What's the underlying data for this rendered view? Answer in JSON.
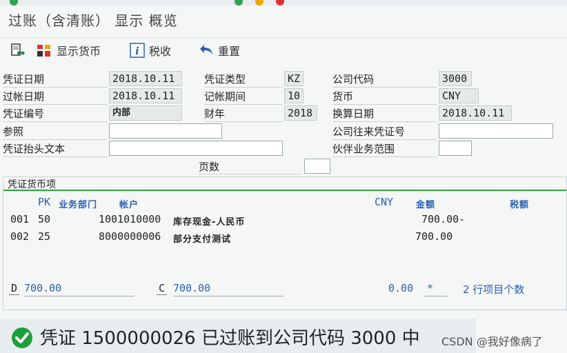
{
  "window": {
    "title": "过账（含清账） 显示 概览"
  },
  "toolbar": {
    "display_currency": "显示货币",
    "tax": "税收",
    "reset": "重置"
  },
  "header": {
    "doc_date_label": "凭证日期",
    "doc_date": "2018.10.11",
    "doc_type_label": "凭证类型",
    "doc_type": "KZ",
    "company_code_label": "公司代码",
    "company_code": "3000",
    "posting_date_label": "过帐日期",
    "posting_date": "2018.10.11",
    "period_label": "记帐期间",
    "period": "10",
    "currency_label": "货币",
    "currency": "CNY",
    "doc_number_label": "凭证编号",
    "doc_number": "内部",
    "fiscal_year_label": "财年",
    "fiscal_year": "2018",
    "translation_date_label": "换算日期",
    "translation_date": "2018.10.11",
    "reference_label": "参照",
    "reference": "",
    "intercompany_label": "公司往来凭证号",
    "intercompany": "",
    "header_text_label": "凭证抬头文本",
    "header_text": "",
    "trading_partner_label": "伙伴业务范围",
    "trading_partner": "",
    "pages_label": "页数",
    "pages": ""
  },
  "items": {
    "title": "凭证货币项",
    "col_pk": "PK",
    "col_business_area": "业务部门",
    "col_account": "帐户",
    "col_currency": "CNY",
    "col_amount": "金额",
    "col_tax": "税额",
    "rows": [
      {
        "line": "001",
        "pk": "50",
        "account": "1001010000",
        "text": "库存现金-人民币",
        "amount": "700.00-"
      },
      {
        "line": "002",
        "pk": "25",
        "account": "8000000006",
        "text": "部分支付测试",
        "amount": "700.00"
      }
    ]
  },
  "totals": {
    "debit_key": "D",
    "debit": "700.00",
    "credit_key": "C",
    "credit": "700.00",
    "balance": "0.00",
    "balance_marker": "*",
    "count_text": "2 行项目个数"
  },
  "status": {
    "message": "凭证 1500000026 已过账到公司代码 3000 中"
  },
  "watermark": "CSDN @我好像病了",
  "colors": {
    "success": "#1e9e3a",
    "accent_blue": "#2b5fb4",
    "rule_green": "#2fa043"
  }
}
